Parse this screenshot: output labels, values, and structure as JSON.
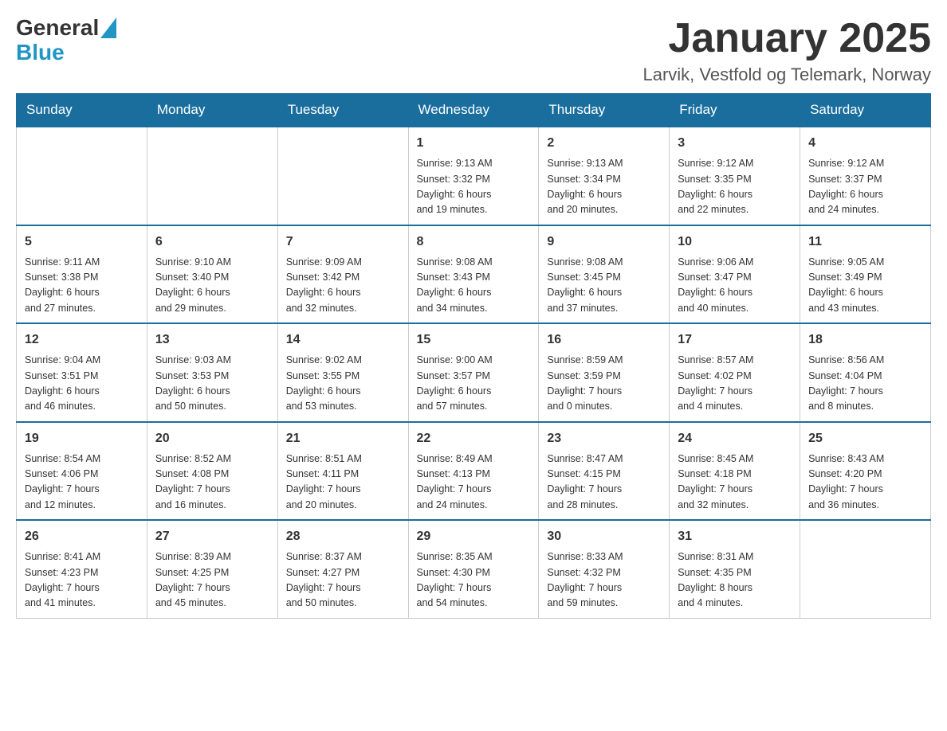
{
  "header": {
    "logo_general": "General",
    "logo_blue": "Blue",
    "month": "January 2025",
    "location": "Larvik, Vestfold og Telemark, Norway"
  },
  "weekdays": [
    "Sunday",
    "Monday",
    "Tuesday",
    "Wednesday",
    "Thursday",
    "Friday",
    "Saturday"
  ],
  "weeks": [
    [
      {
        "day": "",
        "info": ""
      },
      {
        "day": "",
        "info": ""
      },
      {
        "day": "",
        "info": ""
      },
      {
        "day": "1",
        "info": "Sunrise: 9:13 AM\nSunset: 3:32 PM\nDaylight: 6 hours\nand 19 minutes."
      },
      {
        "day": "2",
        "info": "Sunrise: 9:13 AM\nSunset: 3:34 PM\nDaylight: 6 hours\nand 20 minutes."
      },
      {
        "day": "3",
        "info": "Sunrise: 9:12 AM\nSunset: 3:35 PM\nDaylight: 6 hours\nand 22 minutes."
      },
      {
        "day": "4",
        "info": "Sunrise: 9:12 AM\nSunset: 3:37 PM\nDaylight: 6 hours\nand 24 minutes."
      }
    ],
    [
      {
        "day": "5",
        "info": "Sunrise: 9:11 AM\nSunset: 3:38 PM\nDaylight: 6 hours\nand 27 minutes."
      },
      {
        "day": "6",
        "info": "Sunrise: 9:10 AM\nSunset: 3:40 PM\nDaylight: 6 hours\nand 29 minutes."
      },
      {
        "day": "7",
        "info": "Sunrise: 9:09 AM\nSunset: 3:42 PM\nDaylight: 6 hours\nand 32 minutes."
      },
      {
        "day": "8",
        "info": "Sunrise: 9:08 AM\nSunset: 3:43 PM\nDaylight: 6 hours\nand 34 minutes."
      },
      {
        "day": "9",
        "info": "Sunrise: 9:08 AM\nSunset: 3:45 PM\nDaylight: 6 hours\nand 37 minutes."
      },
      {
        "day": "10",
        "info": "Sunrise: 9:06 AM\nSunset: 3:47 PM\nDaylight: 6 hours\nand 40 minutes."
      },
      {
        "day": "11",
        "info": "Sunrise: 9:05 AM\nSunset: 3:49 PM\nDaylight: 6 hours\nand 43 minutes."
      }
    ],
    [
      {
        "day": "12",
        "info": "Sunrise: 9:04 AM\nSunset: 3:51 PM\nDaylight: 6 hours\nand 46 minutes."
      },
      {
        "day": "13",
        "info": "Sunrise: 9:03 AM\nSunset: 3:53 PM\nDaylight: 6 hours\nand 50 minutes."
      },
      {
        "day": "14",
        "info": "Sunrise: 9:02 AM\nSunset: 3:55 PM\nDaylight: 6 hours\nand 53 minutes."
      },
      {
        "day": "15",
        "info": "Sunrise: 9:00 AM\nSunset: 3:57 PM\nDaylight: 6 hours\nand 57 minutes."
      },
      {
        "day": "16",
        "info": "Sunrise: 8:59 AM\nSunset: 3:59 PM\nDaylight: 7 hours\nand 0 minutes."
      },
      {
        "day": "17",
        "info": "Sunrise: 8:57 AM\nSunset: 4:02 PM\nDaylight: 7 hours\nand 4 minutes."
      },
      {
        "day": "18",
        "info": "Sunrise: 8:56 AM\nSunset: 4:04 PM\nDaylight: 7 hours\nand 8 minutes."
      }
    ],
    [
      {
        "day": "19",
        "info": "Sunrise: 8:54 AM\nSunset: 4:06 PM\nDaylight: 7 hours\nand 12 minutes."
      },
      {
        "day": "20",
        "info": "Sunrise: 8:52 AM\nSunset: 4:08 PM\nDaylight: 7 hours\nand 16 minutes."
      },
      {
        "day": "21",
        "info": "Sunrise: 8:51 AM\nSunset: 4:11 PM\nDaylight: 7 hours\nand 20 minutes."
      },
      {
        "day": "22",
        "info": "Sunrise: 8:49 AM\nSunset: 4:13 PM\nDaylight: 7 hours\nand 24 minutes."
      },
      {
        "day": "23",
        "info": "Sunrise: 8:47 AM\nSunset: 4:15 PM\nDaylight: 7 hours\nand 28 minutes."
      },
      {
        "day": "24",
        "info": "Sunrise: 8:45 AM\nSunset: 4:18 PM\nDaylight: 7 hours\nand 32 minutes."
      },
      {
        "day": "25",
        "info": "Sunrise: 8:43 AM\nSunset: 4:20 PM\nDaylight: 7 hours\nand 36 minutes."
      }
    ],
    [
      {
        "day": "26",
        "info": "Sunrise: 8:41 AM\nSunset: 4:23 PM\nDaylight: 7 hours\nand 41 minutes."
      },
      {
        "day": "27",
        "info": "Sunrise: 8:39 AM\nSunset: 4:25 PM\nDaylight: 7 hours\nand 45 minutes."
      },
      {
        "day": "28",
        "info": "Sunrise: 8:37 AM\nSunset: 4:27 PM\nDaylight: 7 hours\nand 50 minutes."
      },
      {
        "day": "29",
        "info": "Sunrise: 8:35 AM\nSunset: 4:30 PM\nDaylight: 7 hours\nand 54 minutes."
      },
      {
        "day": "30",
        "info": "Sunrise: 8:33 AM\nSunset: 4:32 PM\nDaylight: 7 hours\nand 59 minutes."
      },
      {
        "day": "31",
        "info": "Sunrise: 8:31 AM\nSunset: 4:35 PM\nDaylight: 8 hours\nand 4 minutes."
      },
      {
        "day": "",
        "info": ""
      }
    ]
  ]
}
